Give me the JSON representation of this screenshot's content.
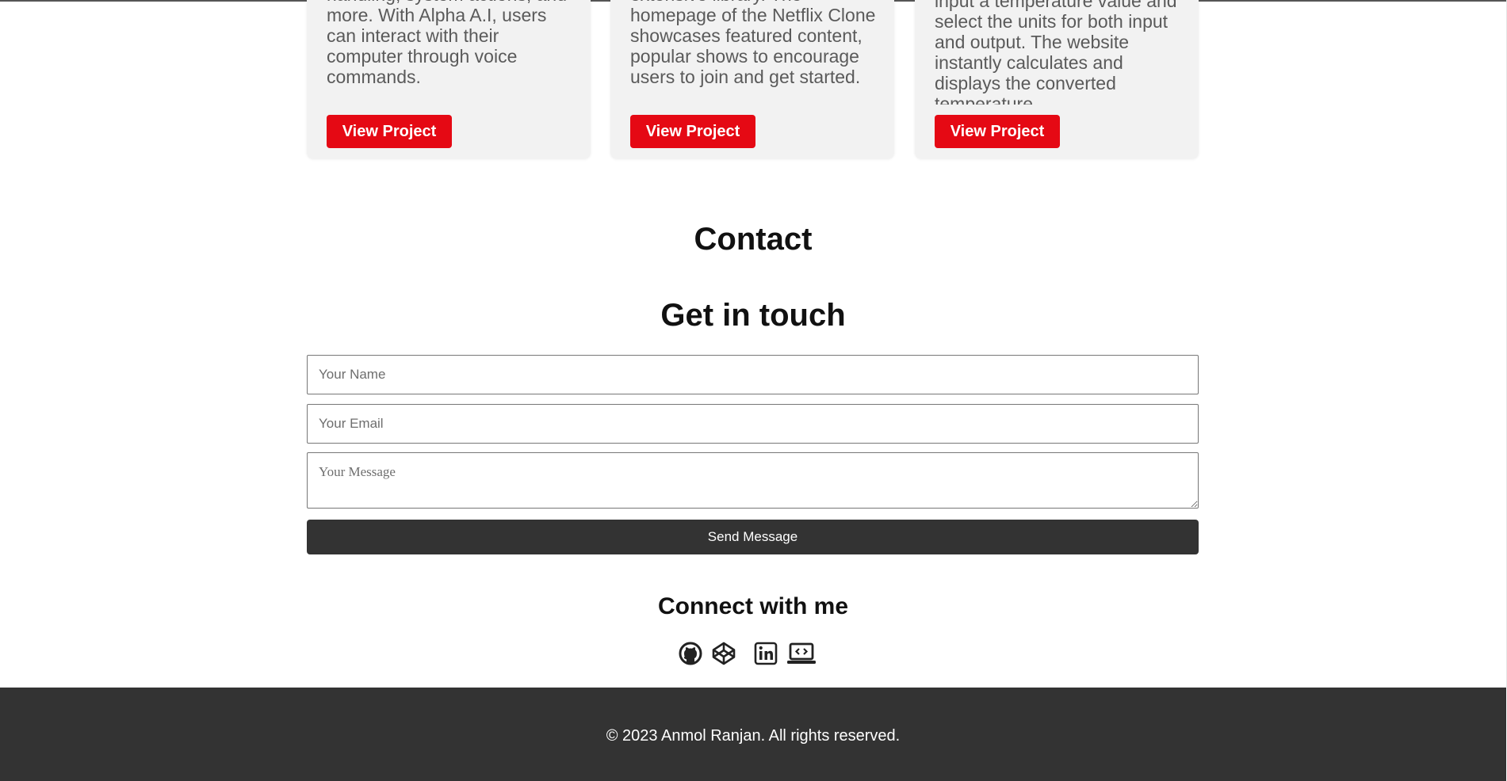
{
  "projects": [
    {
      "description": "handling, system actions, and more. With Alpha A.I, users can interact with their computer through voice commands.",
      "button_label": "View Project"
    },
    {
      "description": "extensive library. The homepage of the Netflix Clone showcases featured content, popular shows to encourage users to join and get started.",
      "button_label": "View Project"
    },
    {
      "description": "input a temperature value and select the units for both input and output. The website instantly calculates and displays the converted temperature.",
      "button_label": "View Project"
    }
  ],
  "contact": {
    "section_title": "Contact",
    "form_title": "Get in touch",
    "name_placeholder": "Your Name",
    "email_placeholder": "Your Email",
    "message_placeholder": "Your Message",
    "send_label": "Send Message"
  },
  "connect": {
    "title": "Connect with me",
    "icons": [
      "github-icon",
      "codepen-icon",
      "linkedin-icon",
      "portfolio-icon"
    ]
  },
  "footer": {
    "text": "© 2023 Anmol Ranjan. All rights reserved."
  },
  "colors": {
    "accent": "#e50914",
    "dark": "#333333",
    "card_bg": "#f2f2f2"
  }
}
